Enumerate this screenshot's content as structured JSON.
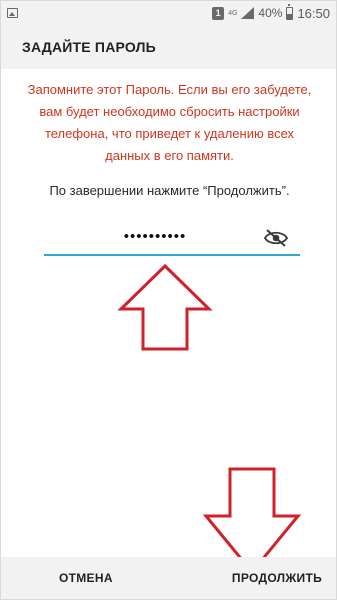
{
  "status_bar": {
    "sim_label": "1",
    "network_type": "4G",
    "battery_percent": "40%",
    "time": "16:50",
    "icons": [
      "gallery-icon",
      "sim-icon",
      "signal-icon",
      "battery-icon"
    ]
  },
  "header": {
    "title": "ЗАДАЙТЕ ПАРОЛЬ"
  },
  "content": {
    "warning": "Запомните этот Пароль. Если вы его забудете, вам будет необходимо сбросить настройки телефона, что приведет к удалению всех данных в его памяти.",
    "hint": "По завершении нажмите “Продолжить”.",
    "password_mask": "••••••••••",
    "visibility_icon": "eye-off-icon"
  },
  "footer": {
    "cancel_label": "ОТМЕНА",
    "continue_label": "ПРОДОЛЖИТЬ"
  },
  "colors": {
    "warning_text": "#d0361f",
    "input_underline": "#2fa9d6",
    "annotation_arrow": "#d0202a",
    "bar_background": "#f2f2f2"
  }
}
